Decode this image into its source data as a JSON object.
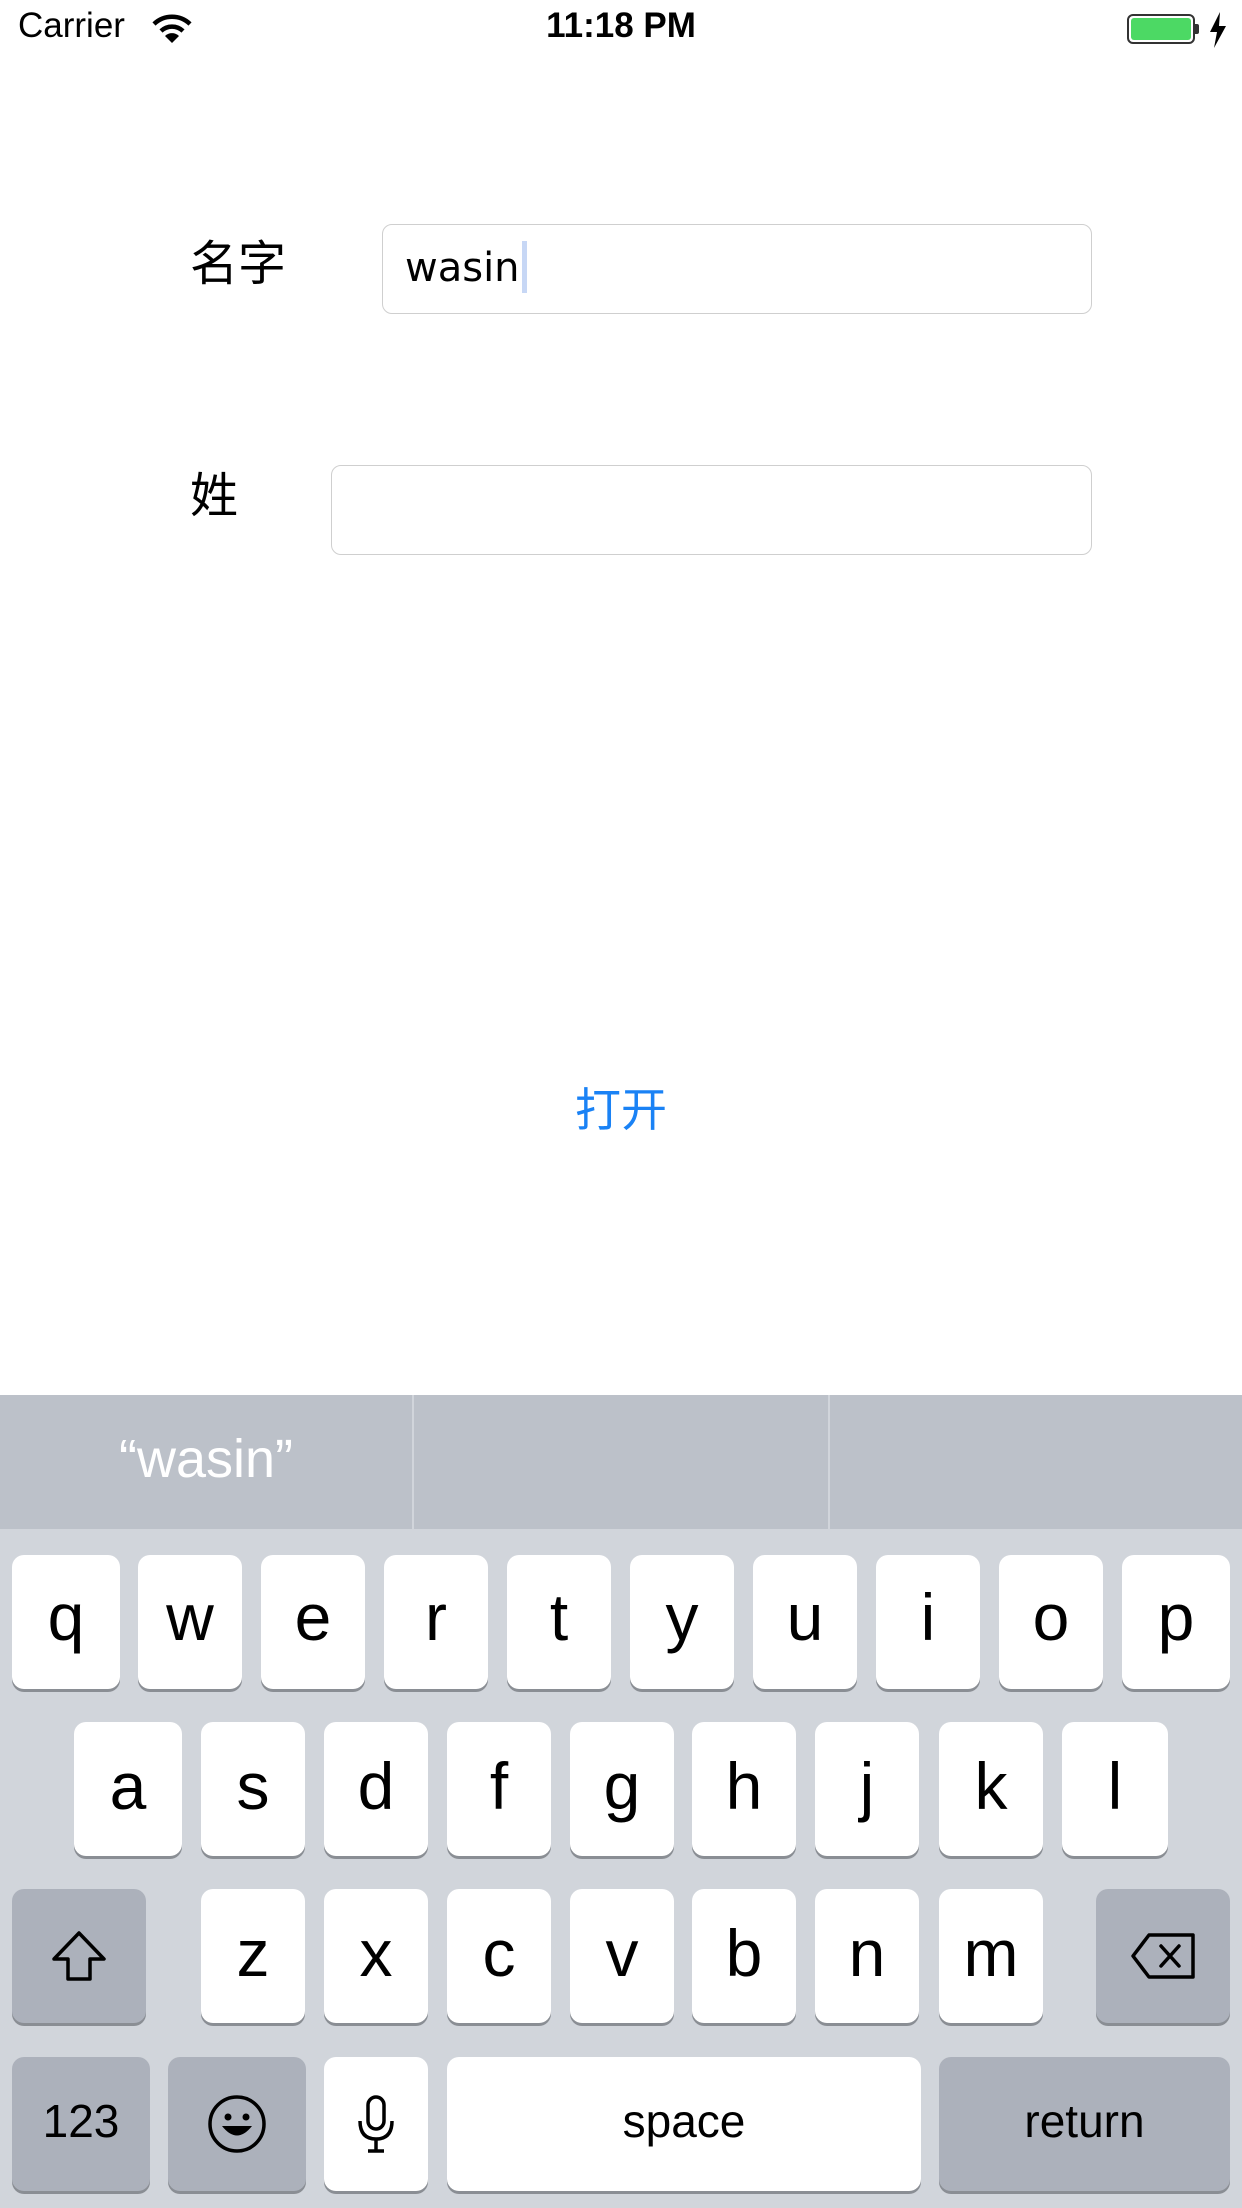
{
  "status_bar": {
    "carrier": "Carrier",
    "time": "11:18 PM",
    "battery_color": "#4cd964"
  },
  "form": {
    "first_name_label": "名字",
    "first_name_value": "wasin",
    "last_name_label": "姓",
    "last_name_value": ""
  },
  "open_button_label": "打开",
  "keyboard": {
    "suggestion": "“wasin”",
    "row1": [
      "q",
      "w",
      "e",
      "r",
      "t",
      "y",
      "u",
      "i",
      "o",
      "p"
    ],
    "row2": [
      "a",
      "s",
      "d",
      "f",
      "g",
      "h",
      "j",
      "k",
      "l"
    ],
    "row3": [
      "z",
      "x",
      "c",
      "v",
      "b",
      "n",
      "m"
    ],
    "numbers_label": "123",
    "space_label": "space",
    "return_label": "return",
    "icons": {
      "shift": "shift-icon",
      "delete": "delete-icon",
      "emoji": "emoji-icon",
      "mic": "microphone-icon"
    }
  },
  "accent_color": "#1a82f5"
}
